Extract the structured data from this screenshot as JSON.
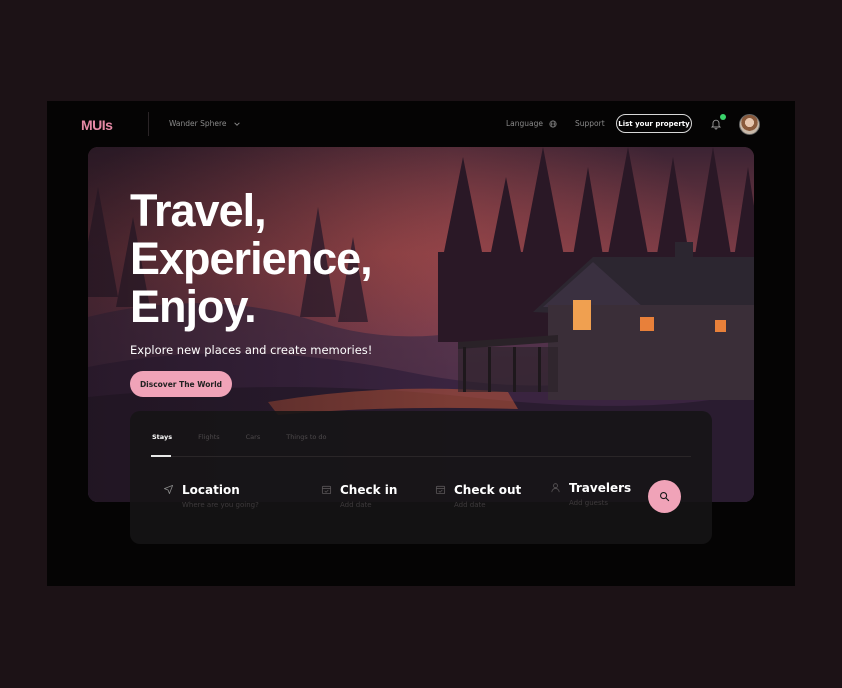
{
  "header": {
    "logo": "MUIs",
    "workspace": "Wander Sphere",
    "language_label": "Language",
    "support_label": "Support",
    "list_property_label": "List your property",
    "notification_dot_color": "#3ad36b"
  },
  "hero": {
    "headline": [
      "Travel,",
      "Experience,",
      "Enjoy."
    ],
    "subtitle": "Explore new places and create memories!",
    "cta_label": "Discover The World"
  },
  "search": {
    "tabs": [
      {
        "label": "Stays",
        "active": true
      },
      {
        "label": "Flights",
        "active": false
      },
      {
        "label": "Cars",
        "active": false
      },
      {
        "label": "Things to do",
        "active": false
      }
    ],
    "fields": [
      {
        "label": "Location",
        "placeholder": "Where are you going?",
        "icon": "navigation-icon"
      },
      {
        "label": "Check in",
        "placeholder": "Add date",
        "icon": "calendar-icon"
      },
      {
        "label": "Check out",
        "placeholder": "Add date",
        "icon": "calendar-icon"
      },
      {
        "label": "Travelers",
        "placeholder": "Add guests",
        "icon": "user-icon"
      }
    ]
  },
  "colors": {
    "accent": "#f0a3b8",
    "logo": "#e68aa6",
    "background": "#1c1216"
  }
}
